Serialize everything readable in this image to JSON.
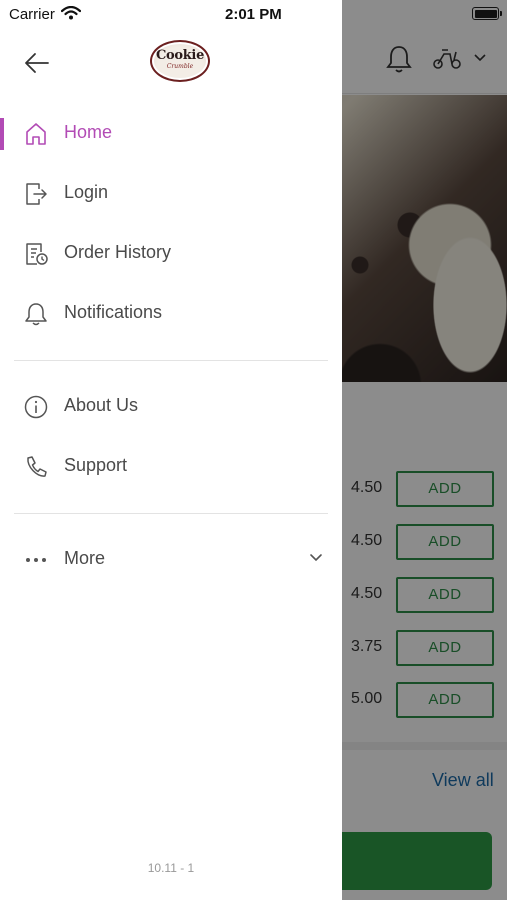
{
  "status_bar": {
    "carrier": "Carrier",
    "time": "2:01 PM"
  },
  "drawer": {
    "logo_text_main": "Cookie",
    "logo_text_sub": "Crumble",
    "menu": [
      {
        "label": "Home",
        "icon": "home-icon",
        "active": true
      },
      {
        "label": "Login",
        "icon": "login-icon",
        "active": false
      },
      {
        "label": "Order History",
        "icon": "order-history-icon",
        "active": false
      },
      {
        "label": "Notifications",
        "icon": "bell-icon",
        "active": false
      },
      {
        "label": "About Us",
        "icon": "info-icon",
        "active": false
      },
      {
        "label": "Support",
        "icon": "phone-icon",
        "active": false
      },
      {
        "label": "More",
        "icon": "more-dots-icon",
        "active": false
      }
    ],
    "version": "10.11 - 1",
    "accent_color": "#b24bb5"
  },
  "background_app": {
    "products": [
      {
        "price": "4.50",
        "button": "ADD"
      },
      {
        "price": "4.50",
        "button": "ADD"
      },
      {
        "price": "4.50",
        "button": "ADD"
      },
      {
        "price": "3.75",
        "button": "ADD"
      },
      {
        "price": "5.00",
        "button": "ADD"
      }
    ],
    "view_all": "View all",
    "accent_green": "#2f8f4a"
  }
}
